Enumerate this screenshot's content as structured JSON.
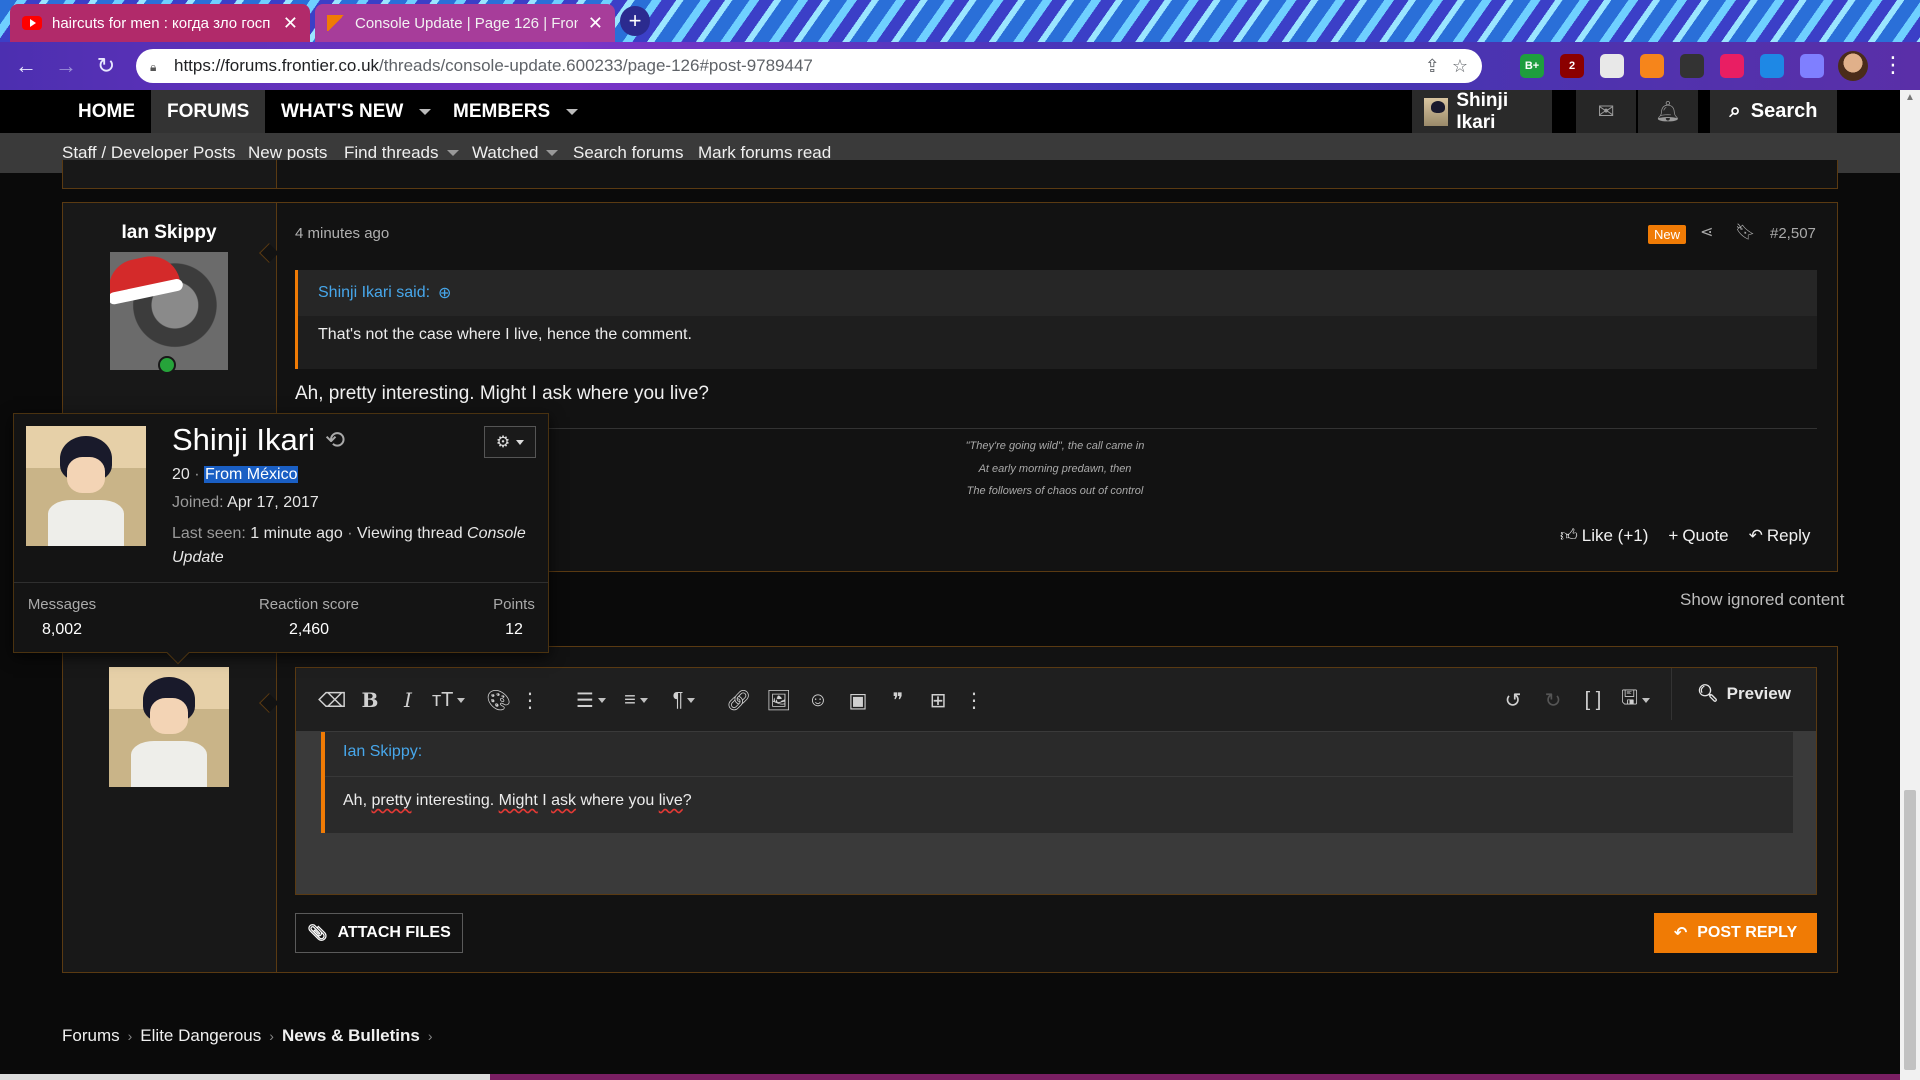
{
  "browser": {
    "tabs": [
      {
        "title": "haircuts for men : когда зло госп",
        "icon": "youtube-icon"
      },
      {
        "title": "Console Update | Page 126 | Fron",
        "icon": "frontier-icon"
      }
    ],
    "url_main": "https://forums.frontier.co.uk",
    "url_path": "/threads/console-update.600233/page-126#post-9789447",
    "extension_badges": [
      "B+",
      "2"
    ]
  },
  "nav": {
    "tabs": [
      "HOME",
      "FORUMS",
      "WHAT'S NEW",
      "MEMBERS"
    ],
    "active_tab": "FORUMS",
    "user": "Shinji Ikari",
    "search": "Search"
  },
  "subnav": {
    "items": [
      "Staff / Developer Posts",
      "New posts",
      "Find threads",
      "Watched",
      "Search forums",
      "Mark forums read"
    ]
  },
  "post": {
    "author": "Ian Skippy",
    "date": "4 minutes ago",
    "badge": "New",
    "number": "#2,507",
    "quote_author": "Shinji Ikari said:",
    "quote_text": "That's not the case where I live, hence the comment.",
    "text": "Ah, pretty interesting. Might I ask where you live?",
    "signature": [
      "\"They're going wild\", the call came in",
      "At early morning predawn, then",
      "The followers of chaos out of control"
    ],
    "actions": {
      "like": "Like (+1)",
      "quote": "Quote",
      "reply": "Reply"
    }
  },
  "show_ignored": "Show ignored content",
  "member_card": {
    "name": "Shinji Ikari",
    "age": "20",
    "location": "From México",
    "joined_label": "Joined:",
    "joined": "Apr 17, 2017",
    "last_seen_label": "Last seen:",
    "last_seen": "1 minute ago",
    "activity": "Viewing thread",
    "activity_thread": "Console Update",
    "stats": [
      {
        "label": "Messages",
        "value": "8,002"
      },
      {
        "label": "Reaction score",
        "value": "2,460"
      },
      {
        "label": "Points",
        "value": "12"
      }
    ]
  },
  "editor": {
    "quote_author": "Ian Skippy:",
    "quote_text_parts": [
      "Ah, ",
      "pretty",
      " interesting. ",
      "Might",
      " I ",
      "ask",
      " where you ",
      "live",
      "?"
    ],
    "preview": "Preview",
    "attach": "ATTACH FILES",
    "post_reply": "POST REPLY"
  },
  "breadcrumb": [
    "Forums",
    "Elite Dangerous",
    "News & Bulletins"
  ],
  "colors": {
    "accent": "#f07b05",
    "link": "#47a7eb",
    "frame": "#5a3a12",
    "online": "#26a33a"
  }
}
